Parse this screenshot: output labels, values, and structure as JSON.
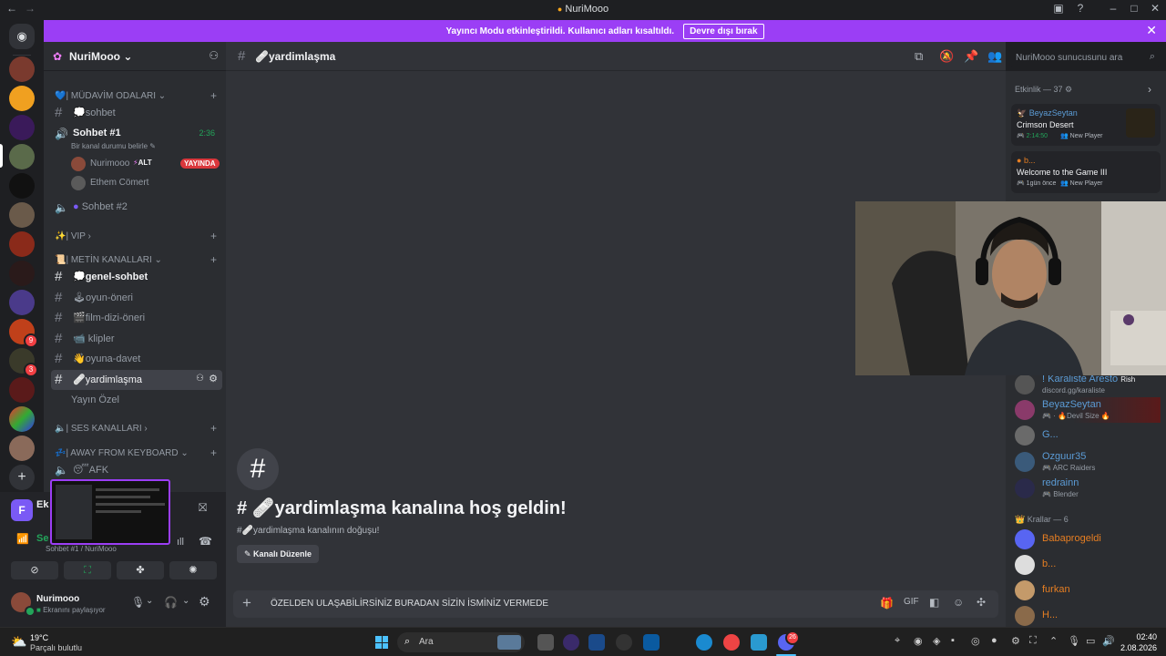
{
  "window": {
    "title": "NuriMooo"
  },
  "banner": {
    "text": "Yayıncı Modu etkinleştirildi. Kullanıcı adları kısaltıldı.",
    "button": "Devre dışı bırak"
  },
  "server": {
    "name": "NuriMooo"
  },
  "sidebar": {
    "cat_mudavim": "| MÜDAVİM ODALARI",
    "ch_sohbet": "sohbet",
    "voice_sohbet1": "Sohbet #1",
    "voice_sohbet1_time": "2:36",
    "voice_status_hint": "Bir kanal durumu belirle",
    "user1": "Nurimooo",
    "user1_tag": "ALT",
    "user1_live": "YAYINDA",
    "user2": "Ethem Cömert",
    "voice_sohbet2": "Sohbet #2",
    "cat_vip": "| VIP",
    "cat_metin": "| METİN KANALLARI",
    "ch_genel": "genel-sohbet",
    "ch_oyun_oneri": "oyun-öneri",
    "ch_film": "film-dizi-öneri",
    "ch_klipler": "klipler",
    "ch_davet": "oyuna-davet",
    "ch_yardim": "yardimlaşma",
    "ch_yayin": "Yayın Özel",
    "cat_ses": "| SES KANALLARI",
    "cat_afk": "| AWAY FROM KEYBOARD",
    "ch_afk": "AFK"
  },
  "voice_panel": {
    "label_partial": "Ek",
    "connection": "Se",
    "caption": "Sohbet #1 / NuriMooo"
  },
  "user_panel": {
    "name": "Nurimooo",
    "status": "Ekranını paylaşıyor"
  },
  "main": {
    "channel": "yardimlaşma",
    "welcome_title": "yardimlaşma kanalına hoş geldin!",
    "welcome_sub": "yardimlaşma kanalının doğuşu!",
    "edit_button": "Kanalı Düzenle",
    "composer_text": "ÖZELDEN ULAŞABİLİRSİNİZ BURADAN SİZİN İSMİNİZ VERMEDE"
  },
  "search": {
    "placeholder": "NuriMooo sunucusunu ara"
  },
  "members": {
    "activity_header": "Etkinlik — 37",
    "card1_user": "BeyazSeytan",
    "card1_game": "Crimson Desert",
    "card1_time": "2:14:50",
    "card1_party": "New Player",
    "card2_user": "b...",
    "card2_game": "Welcome to the Game III",
    "card2_time": "1gün önce",
    "card2_party": "New Player",
    "m1_name": "! Karaliste Aresto",
    "m1_tag": "Rish",
    "m1_sub": "discord.gg/karaliste",
    "m2_name": "BeyazSeytan",
    "m2_sub": "Devil Size",
    "m3_name": "G...",
    "m4_name": "Ozguur35",
    "m4_sub": "ARC Raiders",
    "m5_name": "redrainn",
    "m5_sub": "Blender",
    "kings_header": "Krallar — 6",
    "k1": "Babaprogeldi",
    "k2": "b...",
    "k3": "furkan",
    "k4": "H..."
  },
  "taskbar": {
    "weather_temp": "19°C",
    "weather_desc": "Parçalı bulutlu",
    "search": "Ara",
    "time": "02:40",
    "date": "2.08.2026",
    "discord_badge": "26"
  },
  "colors": {
    "accent": "#9b3ef5",
    "live": "#da373c",
    "online": "#23a55a",
    "link": "#5865f2"
  }
}
